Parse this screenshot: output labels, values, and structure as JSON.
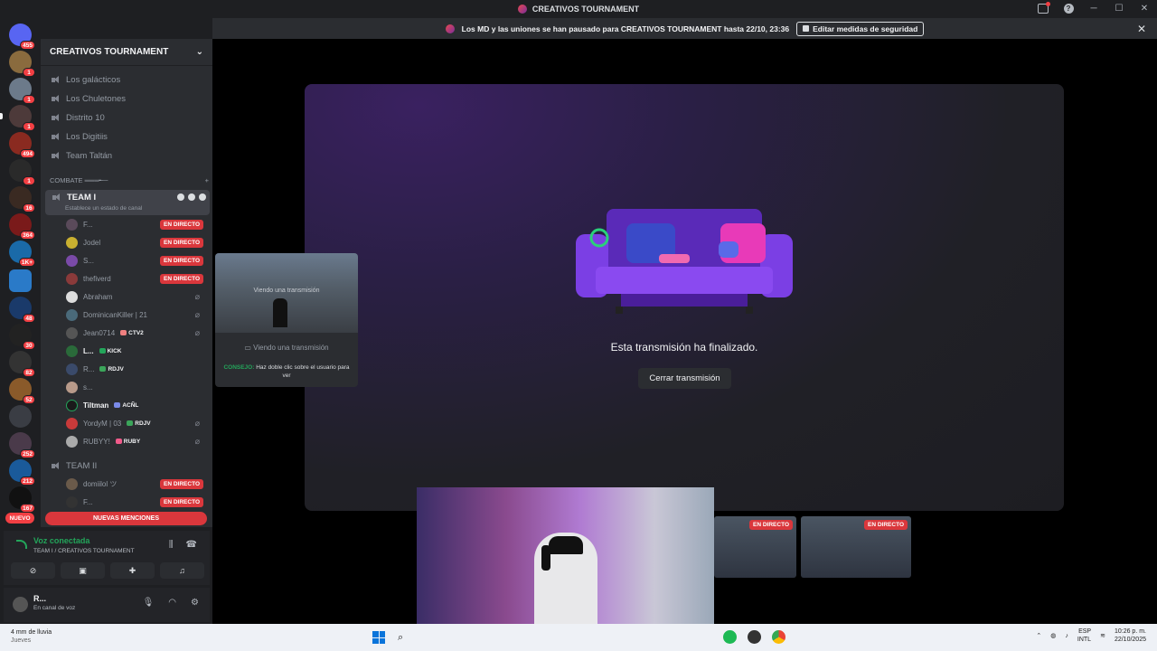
{
  "window": {
    "title": "CREATIVOS TOURNAMENT"
  },
  "banner": {
    "text": "Los MD y las uniones se han pausado para CREATIVOS TOURNAMENT hasta 22/10, 23:36",
    "button": "Editar medidas de seguridad"
  },
  "servers": {
    "badges": [
      "455",
      "1",
      "1",
      "1",
      "1",
      "494",
      "1",
      "16",
      "364",
      "1K+",
      "48",
      "30",
      "82",
      "52",
      "252",
      "212",
      "167"
    ],
    "nuevo": "NUEVO"
  },
  "sidebar": {
    "guild_name": "CREATIVOS TOURNAMENT",
    "channels": [
      "Los galácticos",
      "Los Chuletones",
      "Distrito 10",
      "Los Digitiis",
      "Team Taltán"
    ],
    "category": "COMBATE ═══╾─",
    "active_channel": {
      "name": "TEAM I",
      "status": "Establece un estado de canal"
    },
    "members": [
      {
        "name": "F...",
        "live": "EN DIRECTO"
      },
      {
        "name": "Jodel",
        "live": "EN DIRECTO"
      },
      {
        "name": "S...",
        "live": "EN DIRECTO"
      },
      {
        "name": "thefiverd",
        "live": "EN DIRECTO"
      },
      {
        "name": "Abraham"
      },
      {
        "name": "DominicanKiller | 21"
      },
      {
        "name": "Jean0714",
        "tag": "CTV2"
      },
      {
        "name": "L...",
        "tag": "KICK"
      },
      {
        "name": "R...",
        "tag": "RDJV"
      },
      {
        "name": "s..."
      },
      {
        "name": "Tiltman",
        "tag": "ACÑL"
      },
      {
        "name": "YordyM | 03",
        "tag": "RDJV"
      },
      {
        "name": "RUBYY!",
        "tag": "RUBY"
      }
    ],
    "team2": {
      "name": "TEAM II",
      "members": [
        {
          "name": "domiilol ツ",
          "live": "EN DIRECTO"
        },
        {
          "name": "F...",
          "live": "EN DIRECTO"
        }
      ]
    },
    "mentions_button": "NUEVAS MENCIONES"
  },
  "voice": {
    "status": "Voz conectada",
    "location": "TEAM I / CREATIVOS TOURNAMENT"
  },
  "user": {
    "name": "R...",
    "status": "En canal de voz"
  },
  "stream": {
    "ended_text": "Esta transmisión ha finalizado.",
    "close_button": "Cerrar transmisión"
  },
  "preview": {
    "overlay": "Viendo una transmisión",
    "caption": "Viendo una transmisión",
    "tip_label": "CONSEJO:",
    "tip_text": "Haz doble clic sobre el usuario para ver"
  },
  "thumbs": [
    "EN DIRECTO",
    "EN DIRECTO"
  ],
  "taskbar": {
    "weather": "4 mm de lluvia",
    "weather_day": "Jueves",
    "lang": "ESP",
    "lang_sub": "INTL",
    "time": "10:26 p. m.",
    "date": "22/10/2025"
  },
  "colors": {
    "live_red": "#da373c",
    "connected_green": "#23a55a",
    "accent_purple": "#7b3fe4"
  }
}
